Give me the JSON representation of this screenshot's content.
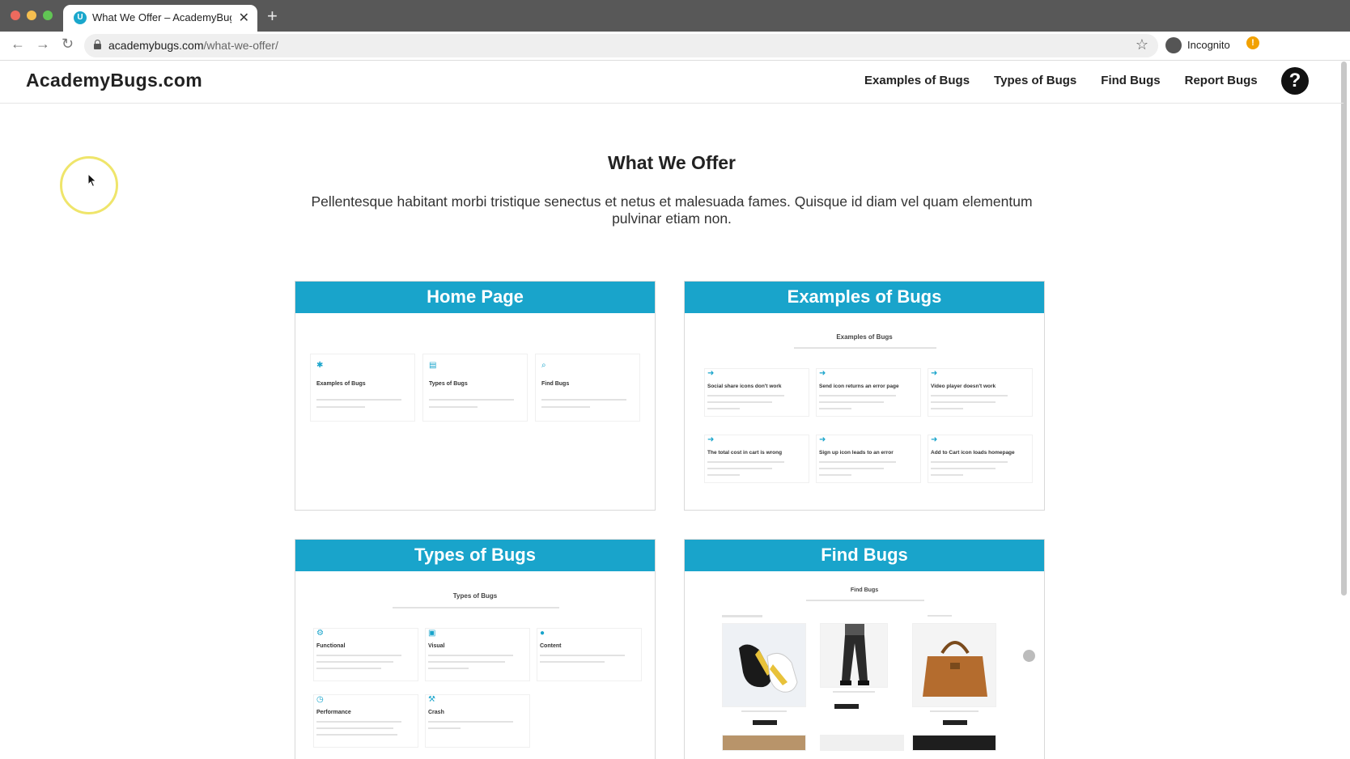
{
  "browser": {
    "tab_title": "What We Offer – AcademyBug",
    "favicon_letter": "U",
    "url_domain": "academybugs.com",
    "url_path": "/what-we-offer/",
    "incognito_label": "Incognito",
    "alert_glyph": "!"
  },
  "site": {
    "logo": "AcademyBugs.com",
    "nav": [
      "Examples of Bugs",
      "Types of Bugs",
      "Find Bugs",
      "Report Bugs"
    ],
    "help_glyph": "?"
  },
  "content": {
    "title": "What We Offer",
    "intro": "Pellentesque habitant morbi tristique senectus et netus et malesuada fames. Quisque id diam vel quam elementum pulvinar etiam non.",
    "cards": [
      {
        "title": "Home Page",
        "items": [
          "Examples of Bugs",
          "Types of Bugs",
          "Find Bugs"
        ]
      },
      {
        "title": "Examples of Bugs",
        "preview_title": "Examples of Bugs",
        "items": [
          "Social share icons don't work",
          "Send icon returns an error page",
          "Video player doesn't work",
          "The total cost in cart is wrong",
          "Sign up icon leads to an error",
          "Add to Cart icon loads homepage"
        ]
      },
      {
        "title": "Types of Bugs",
        "preview_title": "Types of Bugs",
        "items": [
          "Functional",
          "Visual",
          "Content",
          "Performance",
          "Crash"
        ]
      },
      {
        "title": "Find Bugs",
        "preview_title": "Find Bugs"
      }
    ]
  },
  "colors": {
    "accent": "#19a4cb",
    "cursor_ring": "#efe56b"
  }
}
